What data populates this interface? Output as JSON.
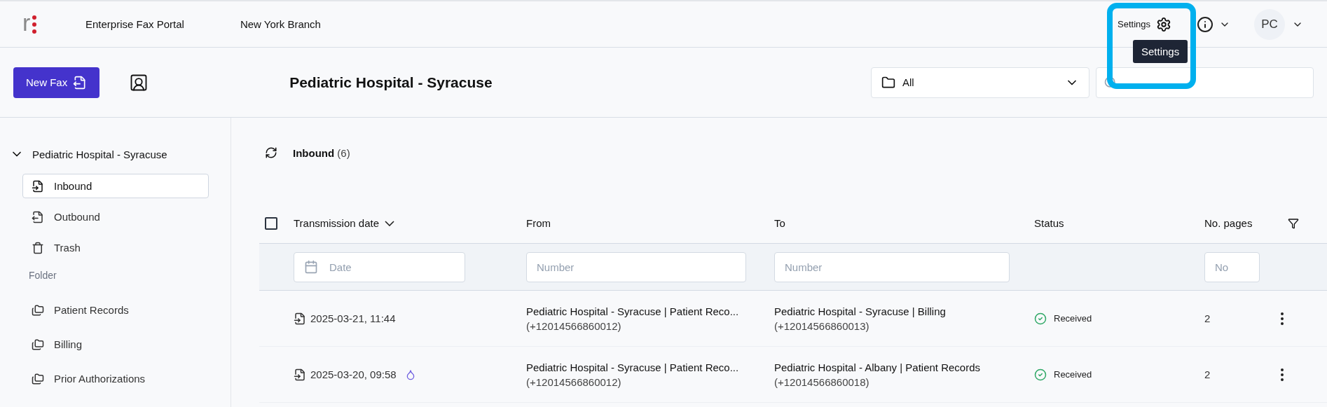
{
  "header": {
    "logo": "r",
    "app_title": "Enterprise Fax Portal",
    "branch": "New York Branch",
    "settings_label": "Settings",
    "settings_tooltip": "Settings",
    "avatar": "PC"
  },
  "toolbar": {
    "new_fax": "New Fax",
    "title": "Pediatric Hospital - Syracuse",
    "folder_select": "All"
  },
  "sidebar": {
    "group": "Pediatric Hospital - Syracuse",
    "expanded": true,
    "items": [
      {
        "kind": "inbound",
        "label": "Inbound",
        "selected": true
      },
      {
        "kind": "outbound",
        "label": "Outbound",
        "selected": false
      },
      {
        "kind": "trash",
        "label": "Trash",
        "selected": false
      }
    ],
    "folder_heading": "Folder",
    "folders": [
      {
        "label": "Patient Records",
        "selected": false
      },
      {
        "label": "Billing",
        "selected": false
      },
      {
        "label": "Prior Authorizations",
        "selected": false
      }
    ]
  },
  "list": {
    "title": "Inbound",
    "count": "(6)"
  },
  "table": {
    "all_checked": false,
    "columns": [
      "Transmission date",
      "From",
      "To",
      "Status",
      "No. pages"
    ],
    "filters": {
      "date": "Date",
      "from": "Number",
      "to": "Number",
      "pages": "No"
    },
    "rows": [
      {
        "date": "2025-03-21, 11:44",
        "marked": false,
        "from": "Pediatric Hospital - Syracuse | Patient Reco...",
        "from_number": "(+12014566860012)",
        "to": "Pediatric Hospital - Syracuse | Billing",
        "to_number": "(+12014566860013)",
        "status": "Received",
        "pages": "2"
      },
      {
        "date": "2025-03-20, 09:58",
        "marked": true,
        "from": "Pediatric Hospital - Syracuse | Patient Reco...",
        "from_number": "(+12014566860012)",
        "to": "Pediatric Hospital - Albany | Patient Records",
        "to_number": "(+12014566860018)",
        "status": "Received",
        "pages": "2"
      }
    ]
  }
}
